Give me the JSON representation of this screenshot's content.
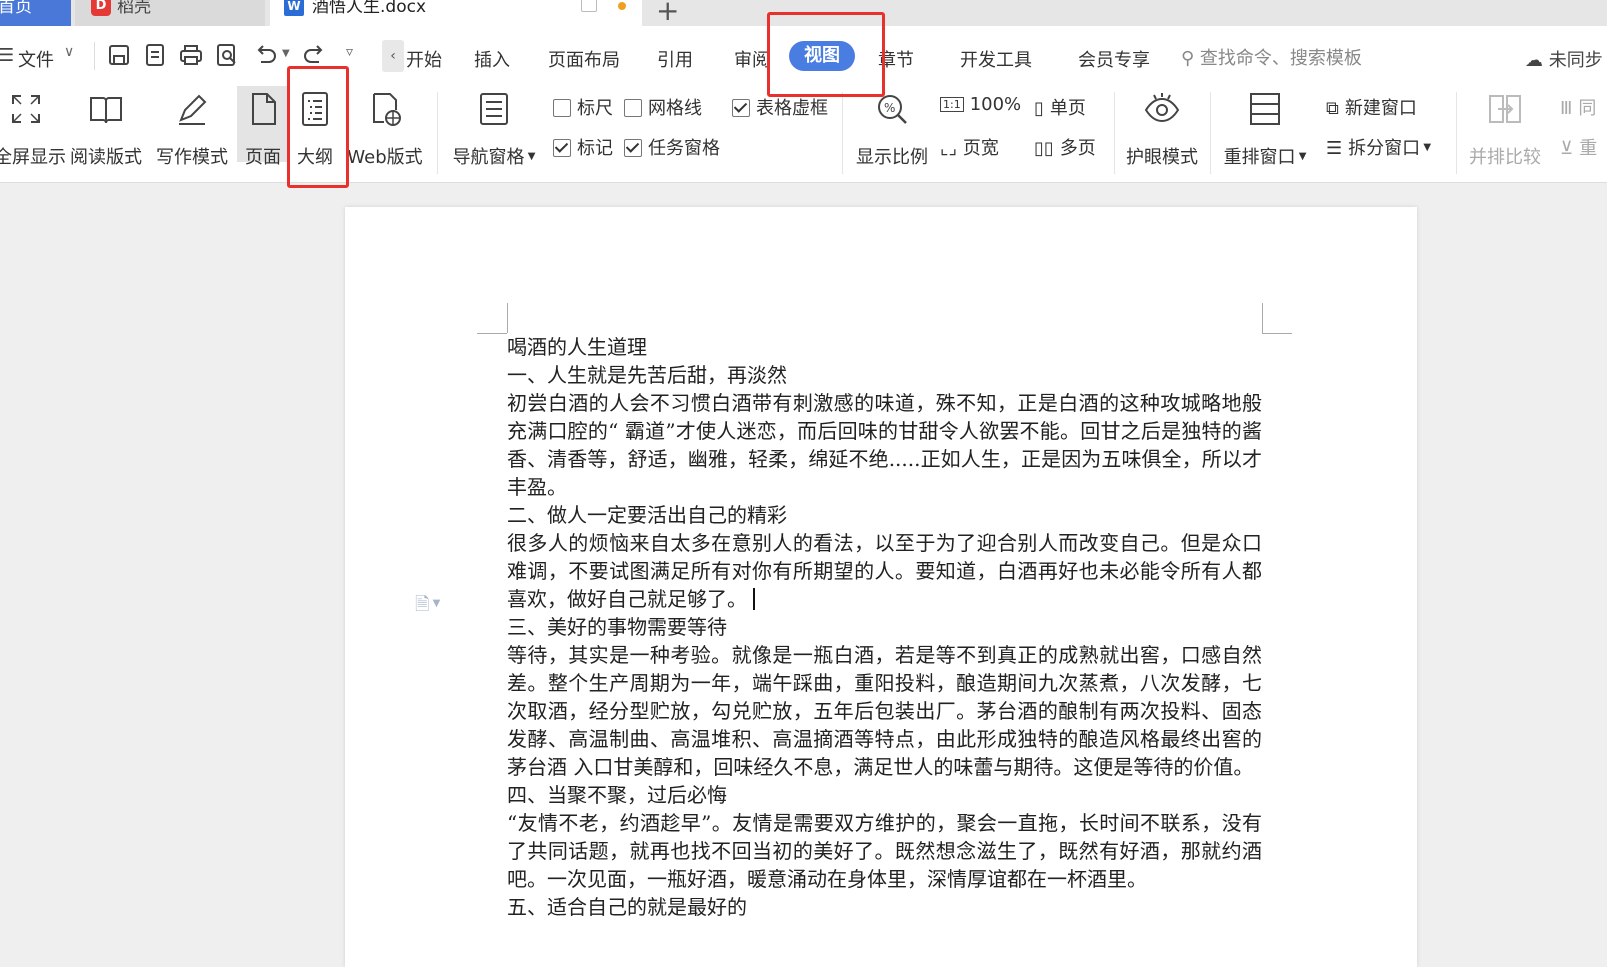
{
  "tabbar": {
    "home_label": "首页",
    "daoke_label": "稻壳",
    "doc_label": "酒悟人生.docx",
    "add_label": "+"
  },
  "menu": {
    "file_label": "文件",
    "start_label": "开始",
    "items": [
      "插入",
      "页面布局",
      "引用",
      "审阅"
    ],
    "view_label": "视图",
    "items_after": [
      "章节",
      "开发工具",
      "会员专享"
    ],
    "search_placeholder": "查找命令、搜索模板",
    "sync_label": "未同步"
  },
  "ribbon": {
    "fullscreen": "全屏显示",
    "reading": "阅读版式",
    "writing": "写作模式",
    "page": "页面",
    "outline": "大纲",
    "web": "Web版式",
    "nav_pane": "导航窗格",
    "ruler": "标尺",
    "gridlines": "网格线",
    "table_gridlines": "表格虚框",
    "marks": "标记",
    "task_pane": "任务窗格",
    "zoom": "显示比例",
    "zoom100": "100%",
    "page_width": "页宽",
    "single_page": "单页",
    "multi_page": "多页",
    "eye_mode": "护眼模式",
    "arrange": "重排窗口",
    "new_window": "新建窗口",
    "split": "拆分窗口",
    "side_by_side": "并排比较",
    "sync_scroll": "同",
    "reset": "重",
    "checked": {
      "ruler": false,
      "gridlines": false,
      "table_gridlines": true,
      "marks": true,
      "task_pane": true
    }
  },
  "document": {
    "paragraphs": [
      "喝酒的人生道理",
      "一、人生就是先苦后甜，再淡然",
      "初尝白酒的人会不习惯白酒带有刺激感的味道，殊不知，正是白酒的这种攻城略地般充满口腔的“ 霸道”才使人迷恋，而后回味的甘甜令人欲罢不能。回甘之后是独特的酱香、清香等，舒适，幽雅，轻柔，绵延不绝.....正如人生，正是因为五味俱全，所以才丰盈。",
      "二、做人一定要活出自己的精彩",
      "很多人的烦恼来自太多在意别人的看法，以至于为了迎合别人而改变自己。但是众口难调，不要试图满足所有对你有所期望的人。要知道，白酒再好也未必能令所有人都喜欢，做好自己就足够了。",
      "三、美好的事物需要等待",
      "等待，其实是一种考验。就像是一瓶白酒，若是等不到真正的成熟就出窖，口感自然差。整个生产周期为一年，端午踩曲，重阳投料，酿造期间九次蒸煮，八次发酵，七次取酒，经分型贮放，勾兑贮放，五年后包装出厂。茅台酒的酿制有两次投料、固态发酵、高温制曲、高温堆积、高温摘酒等特点，由此形成独特的酿造风格最终出窖的茅台酒  入口甘美醇和，回味经久不息，满足世人的味蕾与期待。这便是等待的价值。",
      "四、当聚不聚，过后必悔",
      "“友情不老，约酒趁早”。友情是需要双方维护的，聚会一直拖，长时间不联系，没有了共同话题，就再也找不回当初的美好了。既然想念滋生了，既然有好酒，那就约酒吧。一次见面，一瓶好酒，暖意涌动在身体里，深情厚谊都在一杯酒里。",
      "五、适合自己的就是最好的"
    ]
  },
  "colors": {
    "accent": "#4a7de2",
    "highlight": "#e8312c",
    "home_tab": "#4a78d8"
  }
}
